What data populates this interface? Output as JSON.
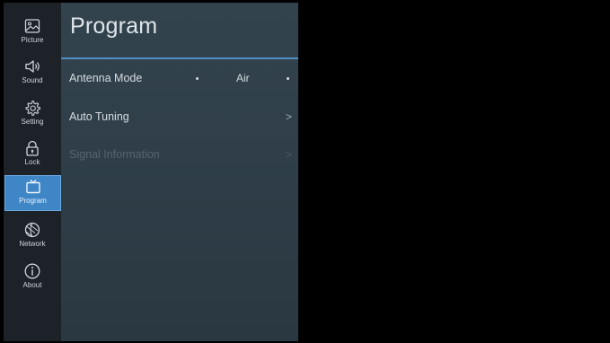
{
  "sidebar": {
    "items": [
      {
        "label": "Picture",
        "icon": "picture-icon",
        "active": false
      },
      {
        "label": "Sound",
        "icon": "speaker-icon",
        "active": false
      },
      {
        "label": "Setting",
        "icon": "gear-icon",
        "active": false
      },
      {
        "label": "Lock",
        "icon": "lock-icon",
        "active": false
      },
      {
        "label": "Program",
        "icon": "tv-icon",
        "active": true
      },
      {
        "label": "Network",
        "icon": "globe-icon",
        "active": false
      },
      {
        "label": "About",
        "icon": "info-icon",
        "active": false
      }
    ]
  },
  "panel": {
    "title": "Program",
    "accent_color": "#4f8fc3",
    "rows": [
      {
        "label": "Antenna Mode",
        "value": "Air",
        "disabled": false
      },
      {
        "label": "Auto Tuning",
        "value": "",
        "disabled": false
      },
      {
        "label": "Signal Information",
        "value": "",
        "disabled": true
      }
    ]
  },
  "colors": {
    "sidebar_bg": "#1c2227",
    "active_bg": "#3f86c7",
    "panel_bg": "#33434d",
    "screen_bg": "#000000"
  }
}
